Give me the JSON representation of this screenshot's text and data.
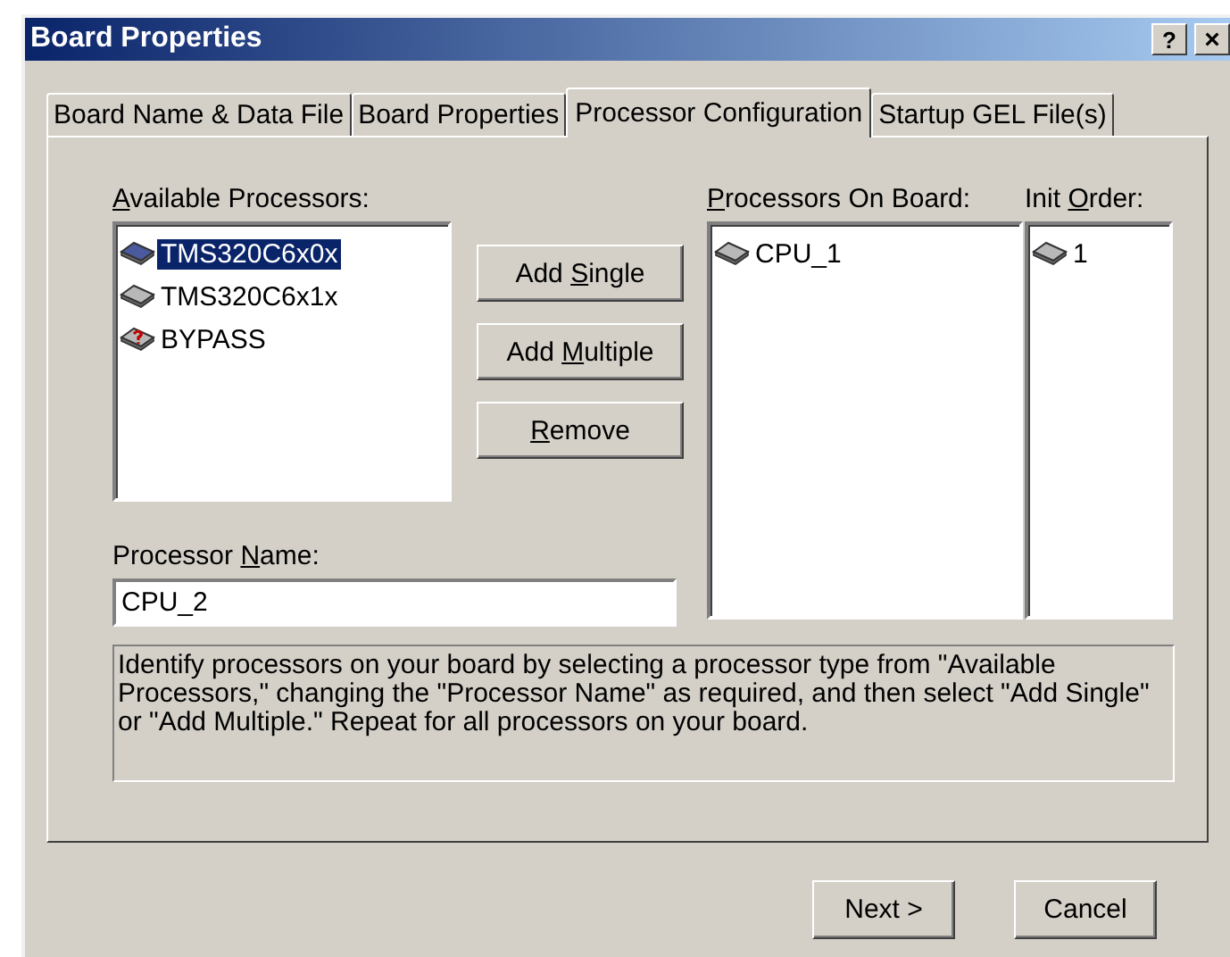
{
  "window": {
    "title": "Board Properties",
    "buttons": [
      {
        "kind": "help",
        "label": "?"
      },
      {
        "kind": "close",
        "label": "×"
      }
    ]
  },
  "tabs": [
    {
      "label": "Board Name & Data File",
      "selected": false
    },
    {
      "label": "Board Properties",
      "selected": false
    },
    {
      "label": "Processor Configuration",
      "selected": true
    },
    {
      "label": "Startup GEL File(s)",
      "selected": false
    }
  ],
  "available": {
    "label": {
      "key": "A",
      "after": "vailable Processors:"
    },
    "items": [
      {
        "name": "TMS320C6x0x",
        "kind": "processor",
        "selected": true
      },
      {
        "name": "TMS320C6x1x",
        "kind": "processor",
        "selected": false
      },
      {
        "name": "BYPASS",
        "kind": "unknown",
        "selected": false
      }
    ]
  },
  "actions": [
    {
      "before": "Add ",
      "key": "S",
      "after": "ingle"
    },
    {
      "before": "Add ",
      "key": "M",
      "after": "ultiple"
    },
    {
      "key": "R",
      "after": "emove"
    }
  ],
  "processor_name": {
    "label": {
      "before": "Processor ",
      "key": "N",
      "after": "ame:"
    },
    "value": "CPU_2"
  },
  "on_board": {
    "label": {
      "key": "P",
      "after": "rocessors On Board:"
    },
    "items": [
      {
        "name": "CPU_1",
        "kind": "processor",
        "selected": false
      }
    ]
  },
  "init_order": {
    "label": {
      "before": "Init ",
      "key": "O",
      "after": "rder:"
    },
    "items": [
      {
        "name": "1",
        "kind": "processor",
        "selected": false
      }
    ]
  },
  "description": "Identify processors on your board by selecting a processor type from \"Available Processors,\" changing the \"Processor Name\" as required, and then select \"Add Single\" or \"Add Multiple.\"  Repeat for all processors on your board.",
  "footer_buttons": [
    "Next >",
    "Cancel"
  ]
}
